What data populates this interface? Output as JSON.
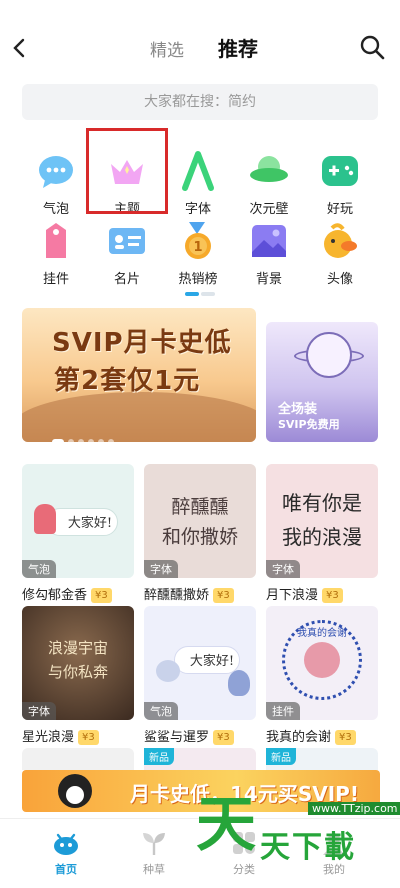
{
  "nav": {
    "back_icon": "chevron-left-icon",
    "tab_featured": "精选",
    "tab_recommend": "推荐",
    "search_icon": "search-icon"
  },
  "search": {
    "placeholder": "大家都在搜：简约"
  },
  "grid": {
    "items": [
      {
        "label": "气泡",
        "icon": "bubble-icon",
        "color": "#4fb3f3"
      },
      {
        "label": "主题",
        "icon": "crown-icon",
        "color": "#e98df0"
      },
      {
        "label": "字体",
        "icon": "letter-a-icon",
        "color": "#3bd37a"
      },
      {
        "label": "次元壁",
        "icon": "ufo-icon",
        "color": "#48cf6e"
      },
      {
        "label": "好玩",
        "icon": "gamepad-icon",
        "color": "#2bc28d"
      },
      {
        "label": "挂件",
        "icon": "tag-icon",
        "color": "#f36f9c"
      },
      {
        "label": "名片",
        "icon": "card-icon",
        "color": "#4aa6f0"
      },
      {
        "label": "热销榜",
        "icon": "medal-icon",
        "color": "#f5a426"
      },
      {
        "label": "背景",
        "icon": "picture-icon",
        "color": "#7d6df0"
      },
      {
        "label": "头像",
        "icon": "duck-avatar-icon",
        "color": "#f7b52e"
      }
    ]
  },
  "banner": {
    "line1": "SVIP月卡史低",
    "line2": "第2套仅1元"
  },
  "side_banner": {
    "line1": "全场装",
    "line2": "SVIP免费用"
  },
  "cards": [
    {
      "name": "修勾郁金香",
      "price": "¥3",
      "tag": "气泡",
      "art": "大家好!",
      "bg": "#e7f3f1"
    },
    {
      "name": "醉醺醺撒娇",
      "price": "¥3",
      "tag": "字体",
      "art": "醉醺醺\n和你撒娇",
      "bg": "#e9dcd8"
    },
    {
      "name": "月下浪漫",
      "price": "¥3",
      "tag": "字体",
      "art": "唯有你是\n我的浪漫",
      "bg": "#f5e0e2"
    },
    {
      "name": "星光浪漫",
      "price": "¥3",
      "tag": "字体",
      "art": "浪漫宇宙\n与你私奔",
      "bg": "#5a4436"
    },
    {
      "name": "鲨鲨与暹罗",
      "price": "¥3",
      "tag": "气泡",
      "art": "大家好!",
      "bg": "#eef0fb"
    },
    {
      "name": "我真的会谢",
      "price": "¥3",
      "tag": "挂件",
      "art": "我真的会谢",
      "bg": "#f3eff7"
    }
  ],
  "new_tags": [
    "新品",
    "新品"
  ],
  "promo": {
    "text": "月卡史低，14元买SVIP!"
  },
  "tabbar": [
    {
      "label": "首页",
      "icon": "home-alien-icon",
      "active": true
    },
    {
      "label": "种草",
      "icon": "sprout-icon",
      "active": false
    },
    {
      "label": "分类",
      "icon": "category-icon",
      "active": false
    },
    {
      "label": "我的",
      "icon": "profile-icon",
      "active": false
    }
  ],
  "watermark": {
    "char": "天",
    "rest": "天下載",
    "url": "www.TTzip.com"
  }
}
